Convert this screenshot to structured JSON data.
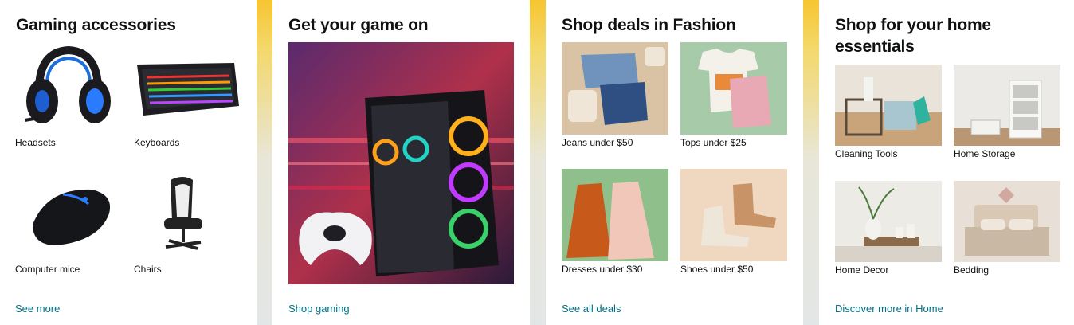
{
  "cards": [
    {
      "title": "Gaming accessories",
      "items": [
        {
          "label": "Headsets",
          "icon": "headset-icon"
        },
        {
          "label": "Keyboards",
          "icon": "keyboard-icon"
        },
        {
          "label": "Computer mice",
          "icon": "mouse-icon"
        },
        {
          "label": "Chairs",
          "icon": "chair-icon"
        }
      ],
      "link": "See more"
    },
    {
      "title": "Get your game on",
      "image": "gaming-pc-with-controller",
      "link": "Shop gaming"
    },
    {
      "title": "Shop deals in Fashion",
      "items": [
        {
          "label": "Jeans under $50"
        },
        {
          "label": "Tops under $25"
        },
        {
          "label": "Dresses under $30"
        },
        {
          "label": "Shoes under $50"
        }
      ],
      "link": "See all deals"
    },
    {
      "title": "Shop for your home essentials",
      "items": [
        {
          "label": "Cleaning Tools"
        },
        {
          "label": "Home Storage"
        },
        {
          "label": "Home Decor"
        },
        {
          "label": "Bedding"
        }
      ],
      "link": "Discover more in Home"
    }
  ],
  "colors": {
    "link": "#007185",
    "text": "#0f1111",
    "accent": "#f7c531"
  }
}
